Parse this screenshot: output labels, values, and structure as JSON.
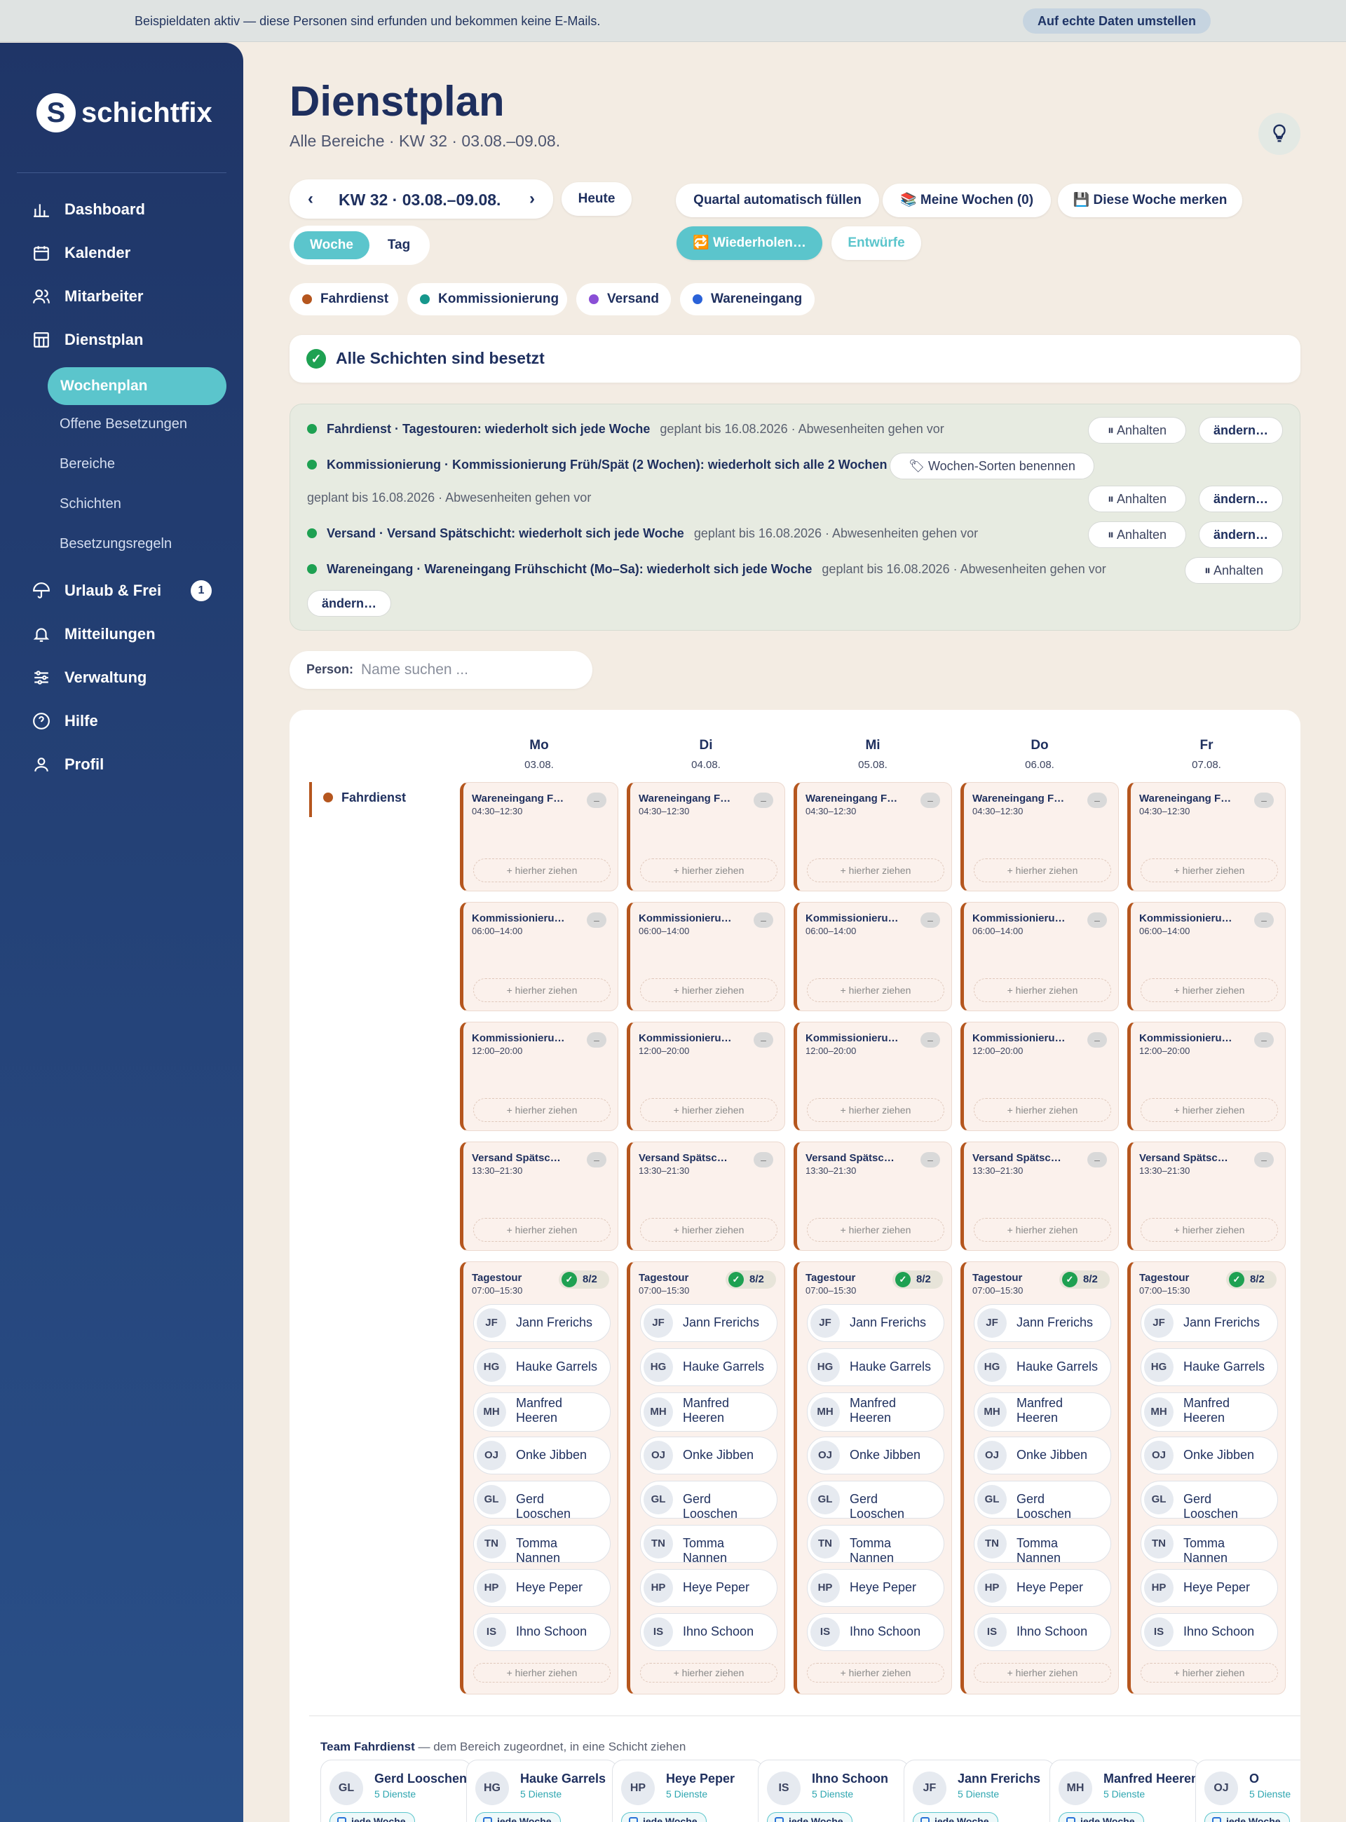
{
  "banner": {
    "text": "Beispieldaten aktiv — diese Personen sind erfunden und bekommen keine E-Mails.",
    "button": "Auf echte Daten umstellen"
  },
  "brand": {
    "name": "schichtfix",
    "mark": "S"
  },
  "nav": {
    "dashboard": "Dashboard",
    "kalender": "Kalender",
    "mitarbeiter": "Mitarbeiter",
    "dienstplan": "Dienstplan",
    "sub": {
      "wochenplan": "Wochenplan",
      "offene": "Offene Besetzungen",
      "bereiche": "Bereiche",
      "schichten": "Schichten",
      "regeln": "Besetzungsregeln"
    },
    "urlaub": "Urlaub & Frei",
    "urlaub_badge": "1",
    "mitteilungen": "Mitteilungen",
    "verwaltung": "Verwaltung",
    "hilfe": "Hilfe",
    "profil": "Profil"
  },
  "page": {
    "title": "Dienstplan",
    "subtitle": "Alle Bereiche · KW 32 · 03.08.–09.08."
  },
  "toolbar": {
    "week": "KW 32 · 03.08.–09.08.",
    "today": "Heute",
    "view_week": "Woche",
    "view_day": "Tag",
    "fill": "Quartal automatisch füllen",
    "my_weeks": "📚 Meine Wochen (0)",
    "remember": "💾 Diese Woche merken",
    "repeat": "🔁 Wiederholen…",
    "drafts": "Entwürfe"
  },
  "areas": [
    {
      "name": "Fahrdienst",
      "color": "#b5561e"
    },
    {
      "name": "Kommissionierung",
      "color": "#16978c"
    },
    {
      "name": "Versand",
      "color": "#8a4fd6"
    },
    {
      "name": "Wareneingang",
      "color": "#2a62d8"
    }
  ],
  "status": {
    "text": "Alle Schichten sind besetzt",
    "icon": "✓"
  },
  "rules": {
    "r1": {
      "title": "Fahrdienst · Tagestouren: wiederholt sich jede Woche",
      "meta": "geplant bis 16.08.2026 · Abwesenheiten gehen vor"
    },
    "r2": {
      "title": "Kommissionierung · Kommissionierung Früh/Spät (2 Wochen): wiederholt sich alle 2 Wochen",
      "extra": "🏷 Wochen-Sorten benennen",
      "meta": "geplant bis 16.08.2026 · Abwesenheiten gehen vor"
    },
    "r3": {
      "title": "Versand · Versand Spätschicht: wiederholt sich jede Woche",
      "meta": "geplant bis 16.08.2026 · Abwesenheiten gehen vor"
    },
    "r4": {
      "title": "Wareneingang · Wareneingang Frühschicht (Mo–Sa): wiederholt sich jede Woche",
      "meta": "geplant bis 16.08.2026 · Abwesenheiten gehen vor"
    },
    "pause": "⏸ Anhalten",
    "change": "ändern…"
  },
  "person": {
    "label": "Person:",
    "placeholder": "Name suchen ..."
  },
  "days": [
    {
      "name": "Mo",
      "date": "03.08."
    },
    {
      "name": "Di",
      "date": "04.08."
    },
    {
      "name": "Mi",
      "date": "05.08."
    },
    {
      "name": "Do",
      "date": "06.08."
    },
    {
      "name": "Fr",
      "date": "07.08."
    }
  ],
  "row_area": "Fahrdienst",
  "shifts": [
    {
      "name": "Wareneingang F…",
      "time": "04:30–12:30",
      "count": "–"
    },
    {
      "name": "Kommissionieru…",
      "time": "06:00–14:00",
      "count": "–"
    },
    {
      "name": "Kommissionieru…",
      "time": "12:00–20:00",
      "count": "–"
    },
    {
      "name": "Versand Spätsc…",
      "time": "13:30–21:30",
      "count": "–"
    }
  ],
  "tour": {
    "name": "Tagestour",
    "time": "07:00–15:30",
    "count": "8/2",
    "check": "✓"
  },
  "drop_label": "+ hierher ziehen",
  "employees": [
    {
      "initials": "JF",
      "name": "Jann Frerichs"
    },
    {
      "initials": "HG",
      "name": "Hauke Garrels"
    },
    {
      "initials": "MH",
      "name": "Manfred Heeren"
    },
    {
      "initials": "OJ",
      "name": "Onke Jibben"
    },
    {
      "initials": "GL",
      "name": "Gerd Looschen"
    },
    {
      "initials": "TN",
      "name": "Tomma Nannen"
    },
    {
      "initials": "HP",
      "name": "Heye Peper"
    },
    {
      "initials": "IS",
      "name": "Ihno Schoon"
    }
  ],
  "team": {
    "title": "Team Fahrdienst",
    "subtitle": " — dem Bereich zugeordnet, in eine Schicht ziehen",
    "services": "5 Dienste",
    "weekly": "jede Woche",
    "members": [
      {
        "initials": "GL",
        "name": "Gerd Looschen"
      },
      {
        "initials": "HG",
        "name": "Hauke Garrels"
      },
      {
        "initials": "HP",
        "name": "Heye Peper"
      },
      {
        "initials": "IS",
        "name": "Ihno Schoon"
      },
      {
        "initials": "JF",
        "name": "Jann Frerichs"
      },
      {
        "initials": "MH",
        "name": "Manfred Heeren"
      },
      {
        "initials": "OJ",
        "name": "O"
      }
    ]
  }
}
